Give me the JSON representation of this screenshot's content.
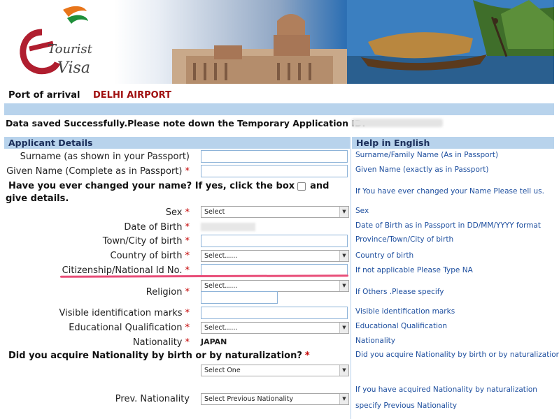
{
  "banner": {
    "logo_top": "Tourist",
    "logo_bottom": "Visa",
    "logo_letter": "e"
  },
  "port": {
    "label": "Port of arrival",
    "value": "DELHI AIRPORT"
  },
  "notice": "Data saved Successfully.Please note down the Temporary Application ID:",
  "section": {
    "left": "Applicant Details",
    "right": "Help in English"
  },
  "fields": {
    "surname": {
      "label": "Surname (as shown in your Passport)",
      "help": "Surname/Family Name (As in Passport)"
    },
    "given": {
      "label": "Given Name (Complete as in Passport)",
      "req": "*",
      "help": "Given Name (exactly as in Passport)"
    },
    "changed": {
      "label_a": "Have you ever changed your name? If yes, click the box",
      "label_b": "and",
      "label_c": "give details.",
      "help": "If You have ever changed your Name Please tell us."
    },
    "sex": {
      "label": "Sex",
      "req": "*",
      "value": "Select",
      "help": "Sex"
    },
    "dob": {
      "label": "Date of Birth",
      "req": "*",
      "help": "Date of Birth as in Passport in DD/MM/YYYY format"
    },
    "town": {
      "label": "Town/City of birth",
      "req": "*",
      "help": "Province/Town/City of birth"
    },
    "country": {
      "label": "Country of birth",
      "req": "*",
      "value": "Select......",
      "help": "Country of birth"
    },
    "citizen": {
      "label": "Citizenship/National Id No.",
      "req": "*",
      "help": "If not applicable Please Type NA"
    },
    "religion": {
      "label": "Religion",
      "req": "*",
      "value": "Select......",
      "help": "If Others .Please specify"
    },
    "marks": {
      "label": "Visible identification marks",
      "req": "*",
      "help": "Visible identification marks"
    },
    "education": {
      "label": "Educational Qualification",
      "req": "*",
      "value": "Select......",
      "help": "Educational Qualification"
    },
    "nationality": {
      "label": "Nationality",
      "req": "*",
      "value": "JAPAN",
      "help": "Nationality"
    },
    "acquire": {
      "label": "Did you acquire Nationality by birth or by naturalization?",
      "req": "*",
      "value": "Select One",
      "help": "Did you acquire Nationality by birth or by naturalization?"
    },
    "prev": {
      "label": "Prev. Nationality",
      "value": "Select Previous Nationality",
      "help_a": "If you have acquired Nationality by naturalization",
      "help_b": "specify Previous Nationality"
    }
  },
  "colors": {
    "header_bar": "#b8d3ec",
    "required": "#c40000",
    "help_text": "#1d4e9e",
    "port_value": "#a01010",
    "highlight": "#e84d78"
  }
}
